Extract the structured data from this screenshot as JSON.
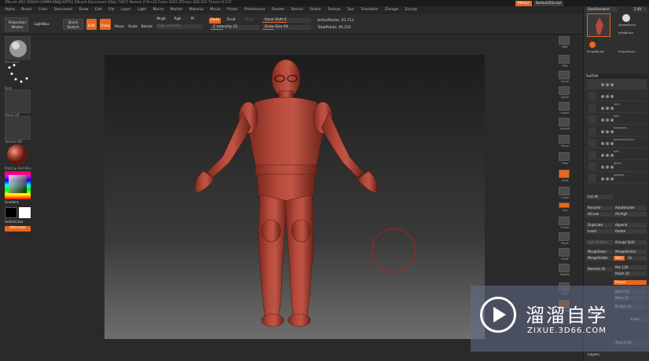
{
  "titlebar": {
    "text": "ZBrush 4R2   [DXHA-GHMM-ANQJ-XZPO]   ZBrush Document   [Objs 7467] Nomos 276+22  Frees 3292  ZTimes 282:321  Timers 0.137"
  },
  "menubar": {
    "items": [
      "Alpha",
      "Brush",
      "Color",
      "Document",
      "Draw",
      "Edit",
      "File",
      "Layer",
      "Light",
      "Macro",
      "Marker",
      "Material",
      "Movie",
      "Picker",
      "Preferences",
      "Render",
      "Stencil",
      "Stroke",
      "Texture",
      "Tool",
      "Transform",
      "Zimage",
      "Zscript"
    ],
    "menus_btn": "Menus",
    "script_label": "DefaultZScript"
  },
  "toptools": {
    "projection_master": "Projection Master",
    "lightbox": "LightBox",
    "quick_sketch": "Quick Sketch",
    "edit": "Edit",
    "draw": "Draw",
    "move": "Move",
    "scale": "Scale",
    "rotate": "Rotate",
    "mrgb": "Mrgb",
    "rgb": "Rgb",
    "m": "M",
    "rgb_intensity": "Rgb Intensity",
    "zadd": "Zadd",
    "zsub": "Zsub",
    "zcut": "Zcut",
    "z_intensity": "Z Intensity 25",
    "focal_shift": "Focal Shift 0",
    "draw_size": "Draw Size 64",
    "active_points": "ActivePoints: 25,713",
    "total_points": "TotalPoints: 95,231"
  },
  "leftpanel": {
    "labels": [
      "Standard",
      "Dots",
      "Alpha Off",
      "Texture Off",
      "MatCap Red Wax"
    ],
    "gradient": "Gradient",
    "switch_color": "SwitchColor",
    "alternate": "Alternate"
  },
  "shelf": {
    "items": [
      "BPR",
      "SPix",
      "Scroll",
      "Zoom",
      "Actual",
      "AAHalf",
      "Persp",
      "Floor",
      "Local",
      "L.Sym",
      "Xyz",
      "Frame",
      "Move",
      "Scale",
      "Rotate",
      "PolyF",
      "Transp"
    ]
  },
  "rightpanel": {
    "brushes": [
      "DamStandard",
      "SphereBrush",
      "InflatBrush",
      "SimpleBrush",
      "EraserBrush"
    ],
    "brush_size": "2.48",
    "subtool_header": "SubTool",
    "subtools": [
      "",
      "",
      "skirt",
      "feet",
      "backpack",
      "shoulderGuard",
      "belt",
      "glove",
      "goggles"
    ],
    "list_all": "List All",
    "rename": "Rename",
    "auto_reorder": "AutoReorder",
    "all_low": "All Low",
    "all_high": "All High",
    "duplicate": "Duplicate",
    "append": "Append",
    "insert": "Insert",
    "delete": "Delete",
    "split_hidden": "Split Hidden",
    "groups_split": "Groups Split",
    "merge_down": "MergeDown",
    "merge_similar": "MergeSimilar",
    "merge_visible": "MergeVisible",
    "weld": "Weld",
    "uv": "Uv",
    "remesh_all": "Remesh All",
    "res": "Res 128",
    "polish": "Polish 10",
    "project": "Project",
    "dist": "Dist 0.02",
    "mean": "Mean 25",
    "pa_blur": "PA Blur 10",
    "inner": "Inner",
    "thick": "Thick 0.02",
    "layers": "Layers"
  },
  "watermark": {
    "title": "溜溜自学",
    "url": "ZIXUE.3D66.COM"
  },
  "colors": {
    "accent": "#e8671f",
    "skin": "#b5493a",
    "skin_dark": "#7a2a20"
  }
}
